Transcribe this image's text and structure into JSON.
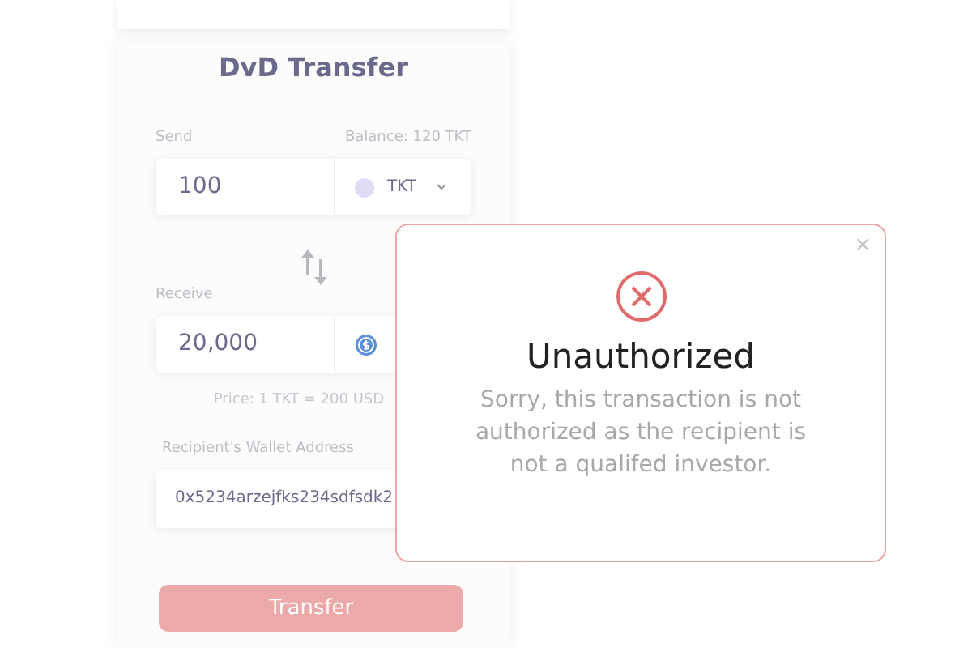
{
  "transfer_card": {
    "title": "DvD Transfer",
    "send": {
      "label": "Send",
      "balance": "Balance: 120 TKT",
      "amount": "100",
      "currency": "TKT"
    },
    "receive": {
      "label": "Receive",
      "amount": "20,000"
    },
    "price": "Price: 1 TKT = 200 USD",
    "wallet": {
      "label": "Recipient's Wallet Address",
      "value": "0x5234arzejfks234sdfsdk2"
    },
    "button": "Transfer"
  },
  "dialog": {
    "close": "×",
    "title": "Unauthorized",
    "message": "Sorry, this transaction is not authorized as the recipient is not a qualifed investor."
  }
}
